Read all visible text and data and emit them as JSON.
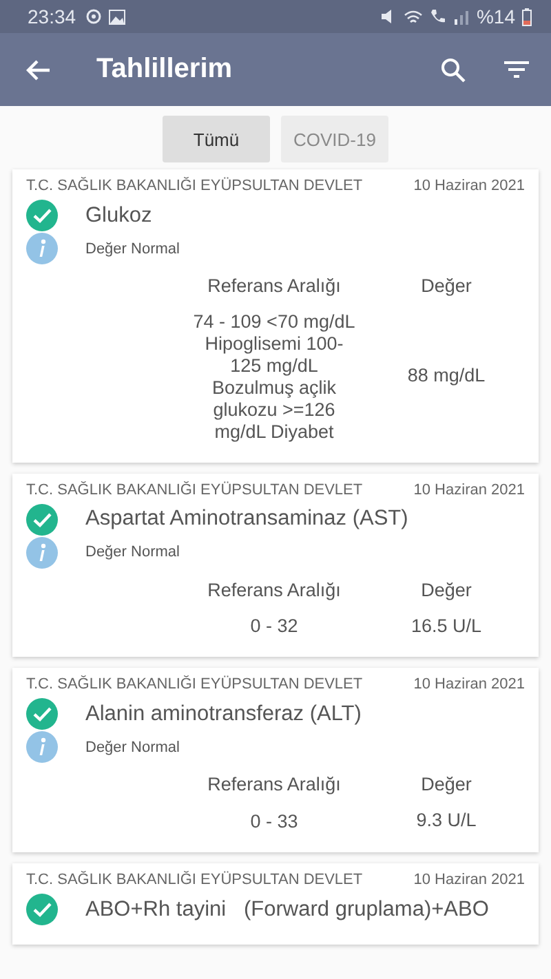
{
  "status_bar": {
    "time": "23:34",
    "battery": "%14"
  },
  "app_bar": {
    "title": "Tahlillerim"
  },
  "tabs": [
    {
      "label": "Tümü",
      "selected": true
    },
    {
      "label": "COVID-19",
      "selected": false
    }
  ],
  "cards": [
    {
      "hospital": "T.C. SAĞLIK BAKANLIĞI EYÜPSULTAN DEVLET",
      "date": "10 Haziran 2021",
      "title": "Glukoz",
      "note": "Değer Normal",
      "range_label": "Referans Aralığı",
      "value_label": "Değer",
      "range": "74 - 109  <70 mg/dL Hipoglisemi 100-125 mg/dL Bozulmuş açlik glukozu >=126 mg/dL Diyabet",
      "value": "88 mg/dL"
    },
    {
      "hospital": "T.C. SAĞLIK BAKANLIĞI EYÜPSULTAN DEVLET",
      "date": "10 Haziran 2021",
      "title": "Aspartat Aminotransaminaz (AST)",
      "note": "Değer Normal",
      "range_label": "Referans Aralığı",
      "value_label": "Değer",
      "range": "0 - 32",
      "value": "16.5 U/L"
    },
    {
      "hospital": "T.C. SAĞLIK BAKANLIĞI EYÜPSULTAN DEVLET",
      "date": "10 Haziran 2021",
      "title": "Alanin aminotransferaz (ALT)",
      "note": "Değer Normal",
      "range_label": "Referans Aralığı",
      "value_label": "Değer",
      "range": "0 - 33",
      "value": "9.3 U/L"
    },
    {
      "hospital": "T.C. SAĞLIK BAKANLIĞI EYÜPSULTAN DEVLET",
      "date": "10 Haziran 2021",
      "title": "ABO+Rh tayini   (Forward gruplama)+ABO"
    }
  ]
}
